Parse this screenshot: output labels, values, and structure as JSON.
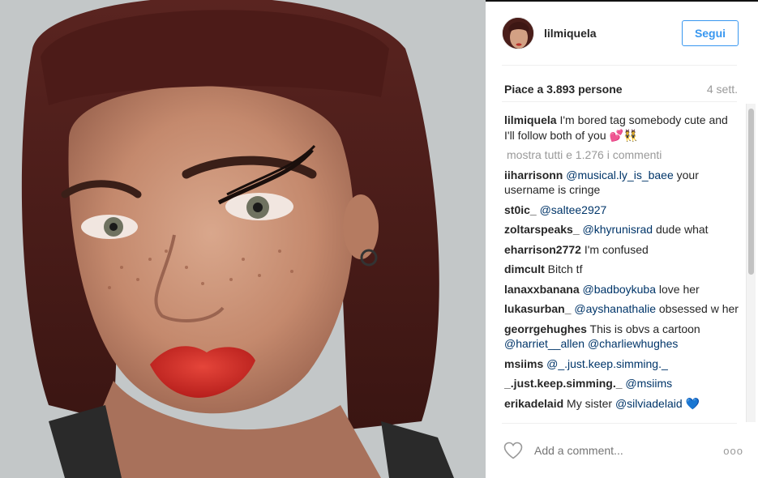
{
  "post": {
    "username": "lilmiquela",
    "follow_label": "Segui",
    "likes": "Piace a 3.893 persone",
    "time_ago": "4 sett.",
    "caption_user": "lilmiquela",
    "caption_text": "I'm bored tag somebody cute and I'll follow both of you 💕👯",
    "show_all": "mostra tutti e 1.276 i commenti",
    "add_comment_placeholder": "Add a comment...",
    "more_label": "ooo"
  },
  "comments": [
    {
      "user": "iiharrisonn",
      "mention": "@musical.ly_is_baee",
      "text": " your username is cringe"
    },
    {
      "user": "st0ic_",
      "mention": "@saltee2927",
      "text": ""
    },
    {
      "user": "zoltarspeaks_",
      "mention": "@khyrunisrad",
      "text": " dude what"
    },
    {
      "user": "eharrison2772",
      "mention": "",
      "text": "I'm confused"
    },
    {
      "user": "dimcult",
      "mention": "",
      "text": "Bitch tf"
    },
    {
      "user": "lanaxxbanana",
      "mention": "@badboykuba",
      "text": " love her"
    },
    {
      "user": "lukasurban_",
      "mention": "@ayshanathalie",
      "text": " obsessed w her"
    },
    {
      "user": "georrgehughes",
      "mention": "",
      "text": "This is obvs a cartoon ",
      "mention2": "@harriet__allen",
      "mention3": "@charliewhughes"
    },
    {
      "user": "msiims",
      "mention": "@_.just.keep.simming._",
      "text": ""
    },
    {
      "user": "_.just.keep.simming._",
      "mention": "@msiims",
      "text": ""
    },
    {
      "user": "erikadelaid",
      "mention": "",
      "text": "My sister ",
      "mention2": "@silviadelaid",
      "text2": " 💙"
    }
  ],
  "colors": {
    "accent": "#3897f0",
    "mention": "#003569",
    "muted": "#999999"
  },
  "icons": [
    "heart-icon",
    "more-options-icon"
  ]
}
